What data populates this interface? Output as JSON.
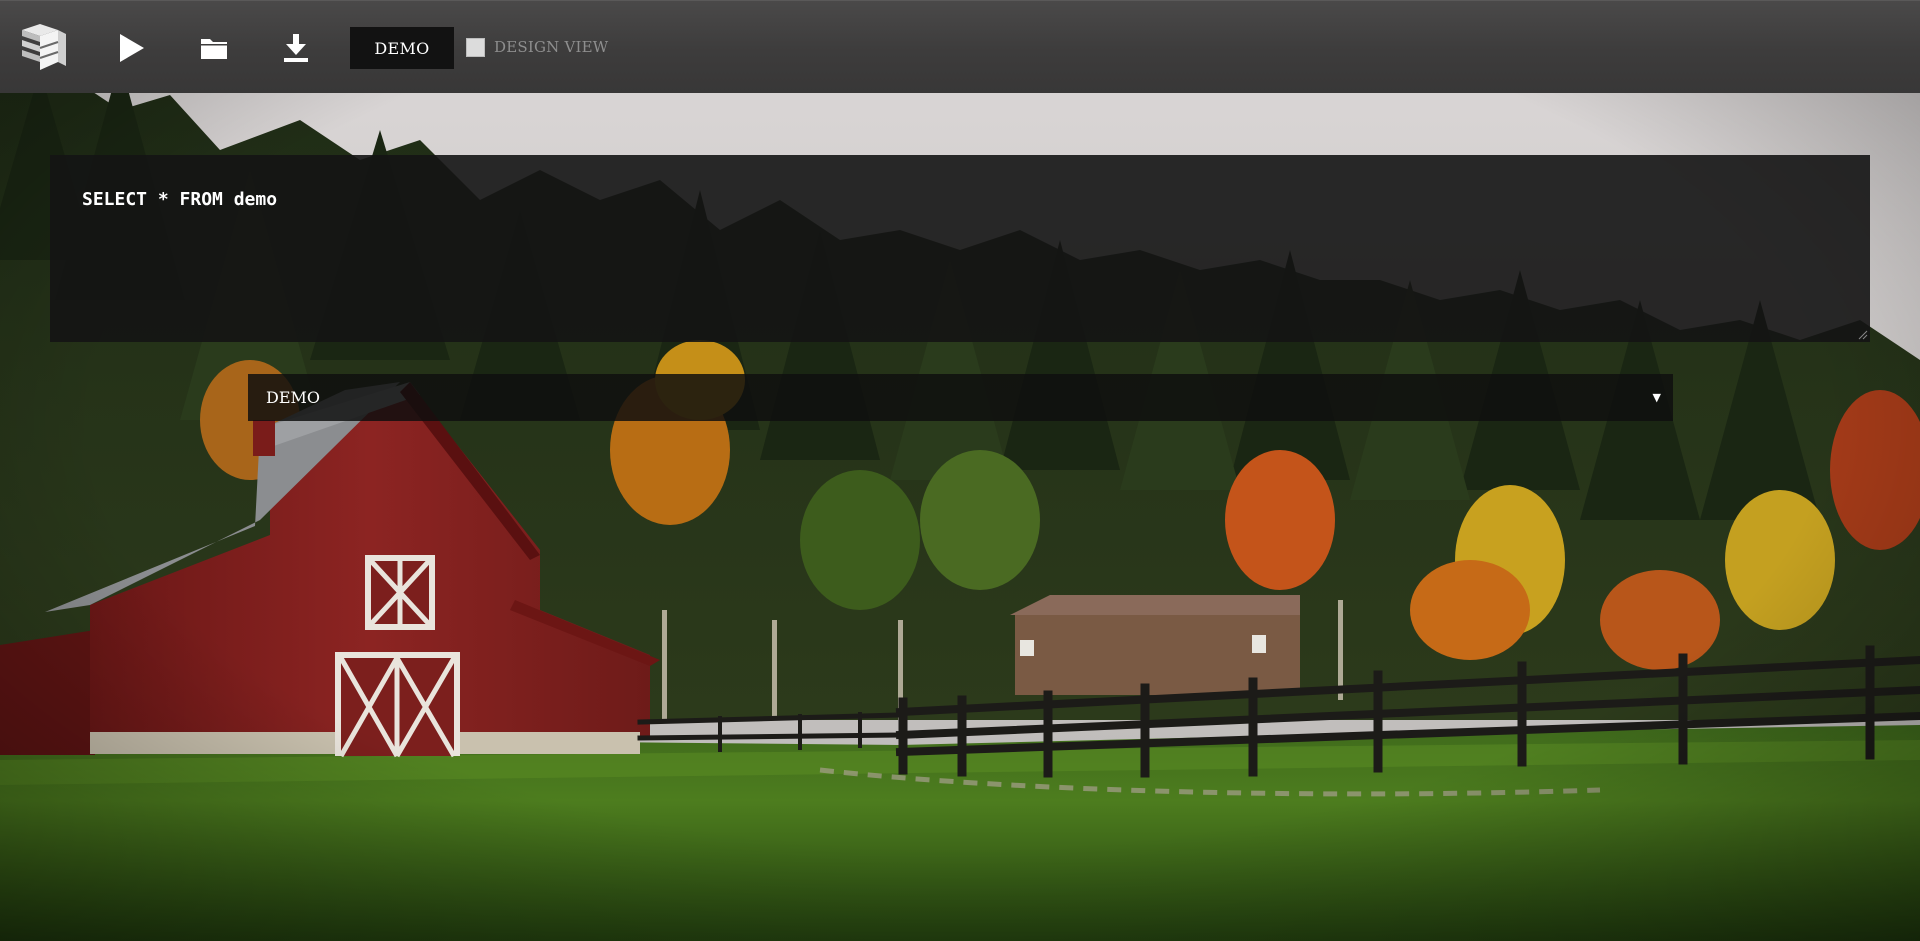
{
  "toolbar": {
    "icons": {
      "logo": "stacked-layers-logo",
      "run": "play-icon",
      "open": "folder-icon",
      "download": "download-icon"
    },
    "tab_label": "DEMO",
    "design_view": {
      "label": "DESIGN VIEW",
      "checked": false
    }
  },
  "editor": {
    "query": "SELECT * FROM demo"
  },
  "connection": {
    "selected": "DEMO",
    "arrow": "▼"
  },
  "colors": {
    "toolbar_bg": "#434242",
    "tab_bg": "#121212",
    "editor_bg": "#141414",
    "text": "#ffffff",
    "muted_text": "#8e8e8e"
  }
}
